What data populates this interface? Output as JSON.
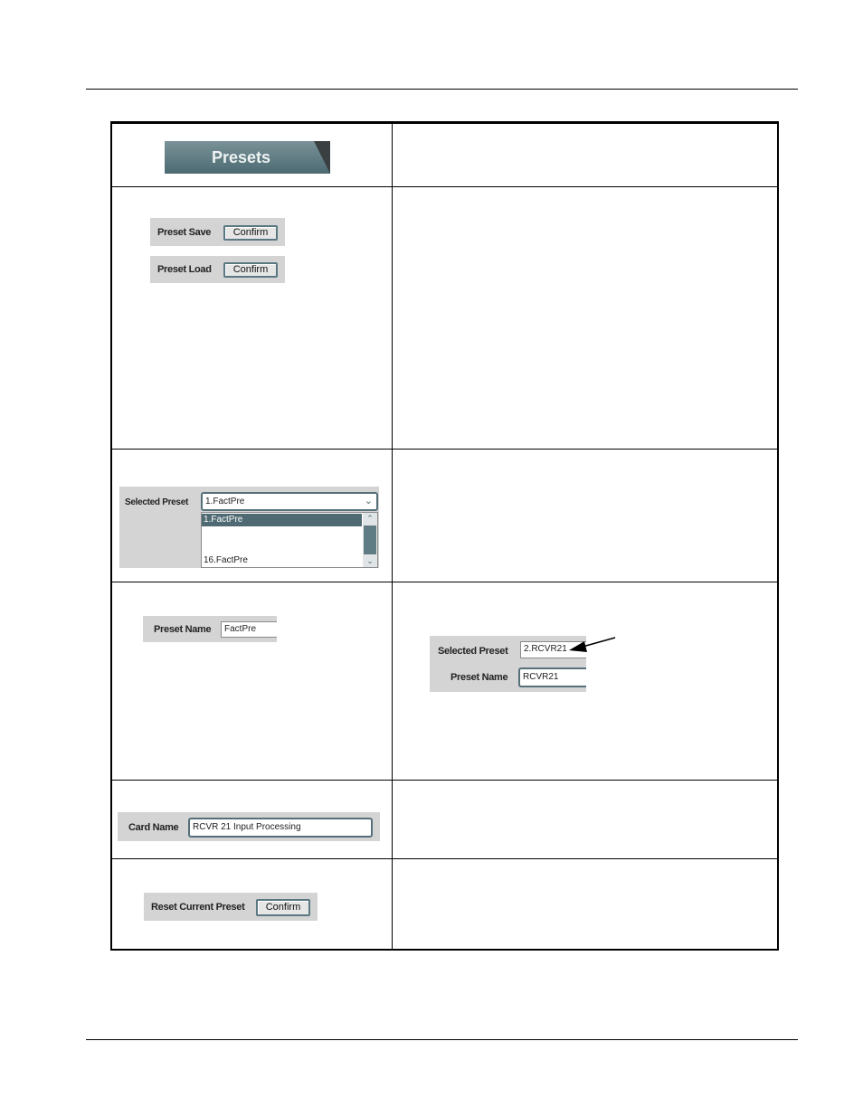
{
  "header": {
    "tab_label": "Presets"
  },
  "rows": {
    "preset_save": {
      "label": "Preset Save",
      "button": "Confirm"
    },
    "preset_load": {
      "label": "Preset Load",
      "button": "Confirm"
    },
    "selected_preset": {
      "label": "Selected Preset",
      "value": "1.FactPre",
      "options": [
        "1.FactPre",
        "16.FactPre"
      ]
    },
    "preset_name": {
      "label": "Preset Name",
      "value": "FactPre"
    },
    "example": {
      "selected_label": "Selected Preset",
      "selected_value": "2.RCVR21",
      "name_label": "Preset Name",
      "name_value": "RCVR21"
    },
    "card_name": {
      "label": "Card Name",
      "value": "RCVR 21 Input Processing"
    },
    "reset": {
      "label": "Reset Current Preset",
      "button": "Confirm"
    }
  }
}
